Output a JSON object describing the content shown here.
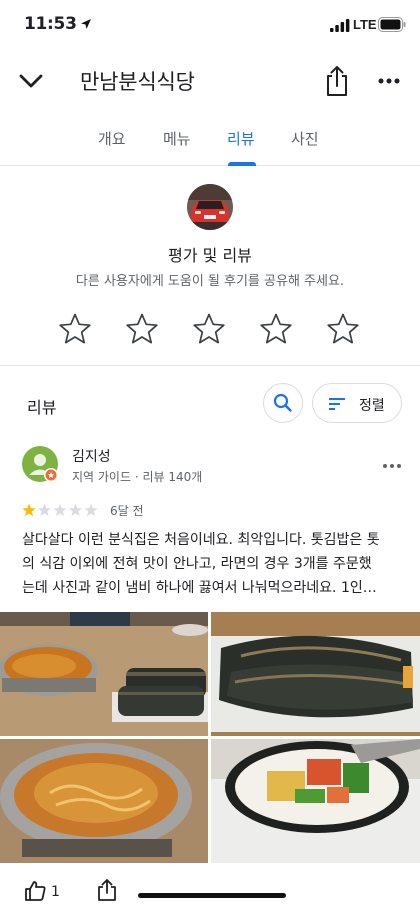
{
  "status_bar": {
    "time": "11:53",
    "network": "LTE"
  },
  "header": {
    "title": "만남분식식당"
  },
  "tabs": [
    {
      "label": "개요"
    },
    {
      "label": "메뉴"
    },
    {
      "label": "리뷰",
      "active": true
    },
    {
      "label": "사진"
    }
  ],
  "rate": {
    "title": "평가 및 리뷰",
    "subtitle": "다른 사용자에게 도움이 될 후기를 공유해 주세요.",
    "star_count": 5
  },
  "reviews": {
    "label": "리뷰",
    "sort_label": "정렬",
    "items": [
      {
        "name": "김지성",
        "meta": "지역 가이드 · 리뷰 140개",
        "rating": 1,
        "max_rating": 5,
        "date": "6달 전",
        "text_lines": [
          "살다살다 이런 분식집은 처음이네요. 최악입니다. 톳김밥은 톳",
          "의 식감 이외에 전혀 맛이 안나고, 라면의 경우 3개를 주문했",
          "는데 사진과 같이 냄비 하나에 끓여서 나눠먹으라네요. 1인…"
        ],
        "likes": "1"
      }
    ]
  },
  "colors": {
    "accent": "#1a73e8",
    "star_filled": "#f9bb04",
    "star_empty": "#dadce0"
  },
  "icons": [
    "back-chevron-icon",
    "share-icon",
    "more-horizontal-icon",
    "search-icon",
    "sort-icon",
    "thumbs-up-icon",
    "star-outline-icon"
  ]
}
